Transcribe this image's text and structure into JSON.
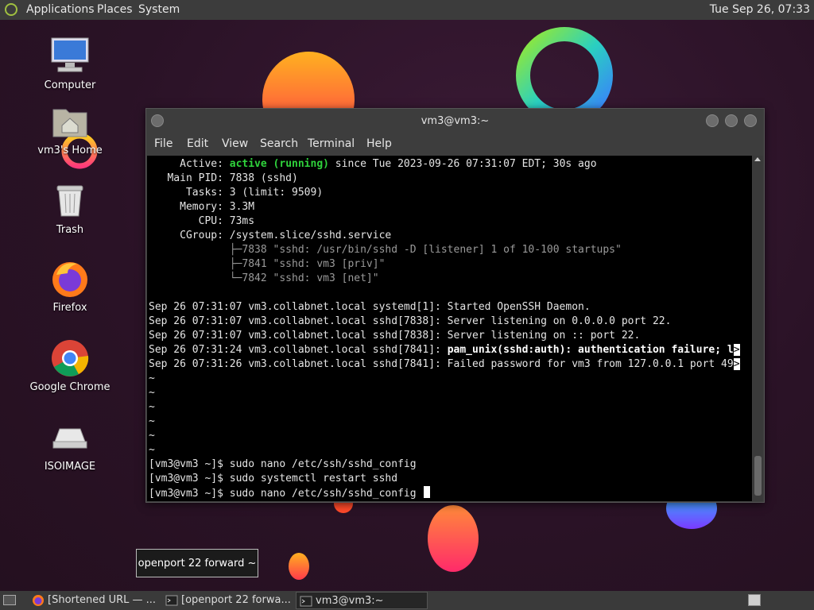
{
  "top_panel": {
    "menus": [
      "Applications",
      "Places",
      "System"
    ],
    "clock": "Tue Sep 26, 07:33"
  },
  "desktop_icons": [
    {
      "label": "Computer",
      "icon": "computer-icon"
    },
    {
      "label": "vm3's Home",
      "icon": "home-folder-icon"
    },
    {
      "label": "Trash",
      "icon": "trash-icon"
    },
    {
      "label": "Firefox",
      "icon": "firefox-icon"
    },
    {
      "label": "Google Chrome",
      "icon": "chrome-icon"
    },
    {
      "label": "ISOIMAGE",
      "icon": "drive-icon"
    }
  ],
  "terminal": {
    "title": "vm3@vm3:~",
    "menu": [
      "File",
      "Edit",
      "View",
      "Search",
      "Terminal",
      "Help"
    ],
    "status": {
      "active_label": "     Active: ",
      "active_value": "active (running)",
      "active_rest": " since Tue 2023-09-26 07:31:07 EDT; 30s ago",
      "main_pid": "   Main PID: 7838 (sshd)",
      "tasks": "      Tasks: 3 (limit: 9509)",
      "memory": "     Memory: 3.3M",
      "cpu": "        CPU: 73ms",
      "cgroup": "     CGroup: /system.slice/sshd.service",
      "tree": [
        "             ├─7838 \"sshd: /usr/bin/sshd -D [listener] 1 of 10-100 startups\"",
        "             ├─7841 \"sshd: vm3 [priv]\"",
        "             └─7842 \"sshd: vm3 [net]\""
      ]
    },
    "log": [
      "Sep 26 07:31:07 vm3.collabnet.local systemd[1]: Started OpenSSH Daemon.",
      "Sep 26 07:31:07 vm3.collabnet.local sshd[7838]: Server listening on 0.0.0.0 port 22.",
      "Sep 26 07:31:07 vm3.collabnet.local sshd[7838]: Server listening on :: port 22."
    ],
    "log_auth_prefix": "Sep 26 07:31:24 vm3.collabnet.local sshd[7841]: ",
    "log_auth_bold": "pam_unix(sshd:auth): authentication failure; l",
    "log_failed": "Sep 26 07:31:26 vm3.collabnet.local sshd[7841]: Failed password for vm3 from 127.0.0.1 port 49",
    "trunc_marker": ">",
    "tildes": [
      "~",
      "~",
      "~",
      "~",
      "~",
      "~"
    ],
    "commands": [
      "[vm3@vm3 ~]$ sudo nano /etc/ssh/sshd_config",
      "[vm3@vm3 ~]$ sudo systemctl restart sshd",
      "[vm3@vm3 ~]$ sudo nano /etc/ssh/sshd_config "
    ]
  },
  "tooltip": "openport 22 forward ~",
  "taskbar": {
    "items": [
      {
        "label": "[Shortened URL — ...",
        "icon": "firefox-icon"
      },
      {
        "label": "[openport 22 forwa...",
        "icon": "terminal-icon"
      },
      {
        "label": "vm3@vm3:~",
        "icon": "terminal-icon"
      }
    ]
  }
}
